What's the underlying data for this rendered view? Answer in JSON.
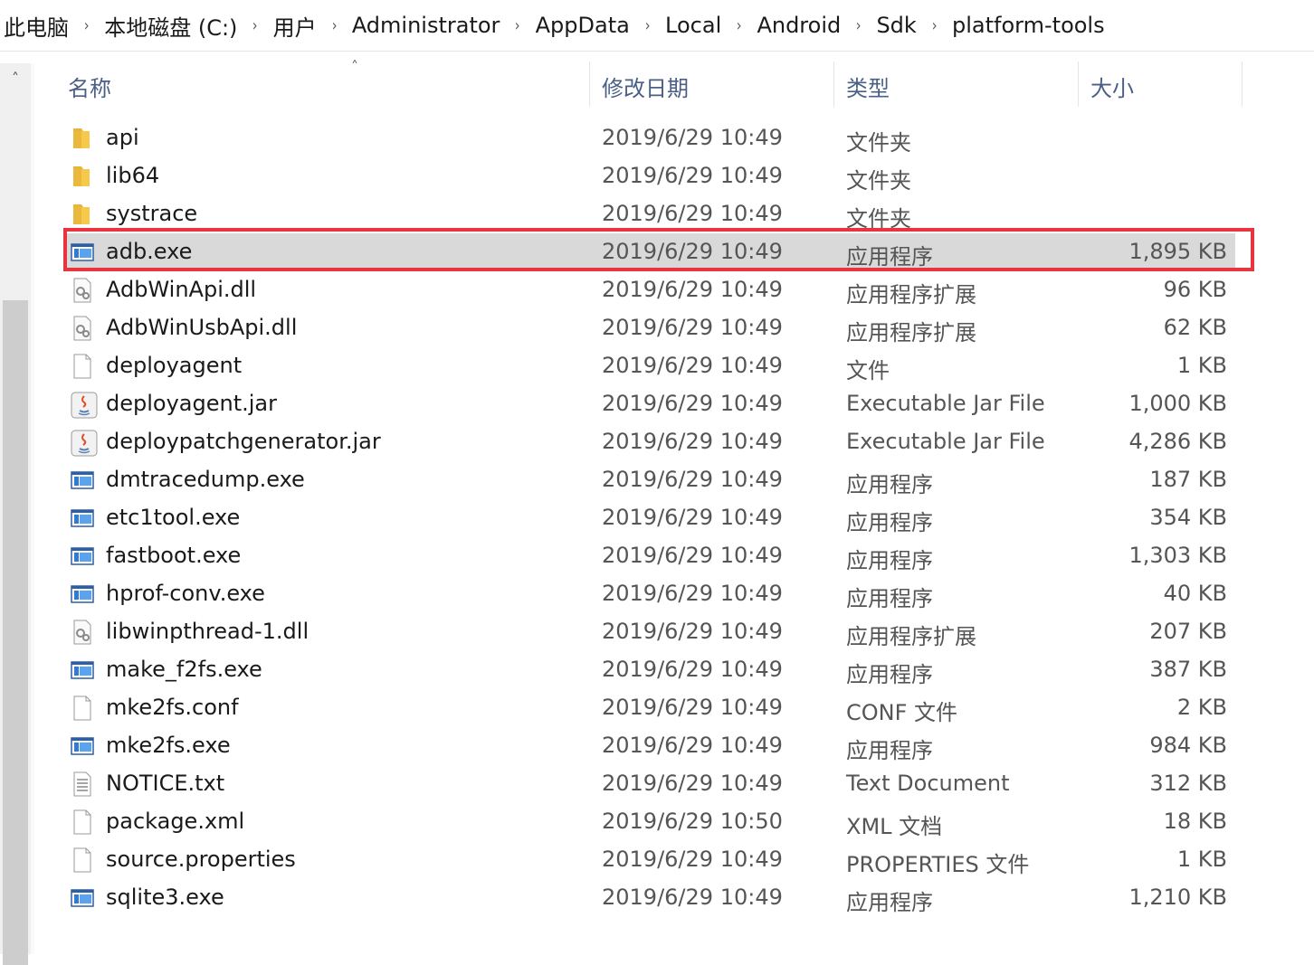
{
  "breadcrumb": [
    "此电脑",
    "本地磁盘 (C:)",
    "用户",
    "Administrator",
    "AppData",
    "Local",
    "Android",
    "Sdk",
    "platform-tools"
  ],
  "columns": {
    "name": "名称",
    "date": "修改日期",
    "type": "类型",
    "size": "大小"
  },
  "files": [
    {
      "name": "api",
      "date": "2019/6/29 10:49",
      "type": "文件夹",
      "size": "",
      "icon": "folder-icon"
    },
    {
      "name": "lib64",
      "date": "2019/6/29 10:49",
      "type": "文件夹",
      "size": "",
      "icon": "folder-icon"
    },
    {
      "name": "systrace",
      "date": "2019/6/29 10:49",
      "type": "文件夹",
      "size": "",
      "icon": "folder-icon"
    },
    {
      "name": "adb.exe",
      "date": "2019/6/29 10:49",
      "type": "应用程序",
      "size": "1,895 KB",
      "icon": "exe-icon",
      "selected": true
    },
    {
      "name": "AdbWinApi.dll",
      "date": "2019/6/29 10:49",
      "type": "应用程序扩展",
      "size": "96 KB",
      "icon": "dll-icon"
    },
    {
      "name": "AdbWinUsbApi.dll",
      "date": "2019/6/29 10:49",
      "type": "应用程序扩展",
      "size": "62 KB",
      "icon": "dll-icon"
    },
    {
      "name": "deployagent",
      "date": "2019/6/29 10:49",
      "type": "文件",
      "size": "1 KB",
      "icon": "file-icon"
    },
    {
      "name": "deployagent.jar",
      "date": "2019/6/29 10:49",
      "type": "Executable Jar File",
      "size": "1,000 KB",
      "icon": "java-icon"
    },
    {
      "name": "deploypatchgenerator.jar",
      "date": "2019/6/29 10:49",
      "type": "Executable Jar File",
      "size": "4,286 KB",
      "icon": "java-icon"
    },
    {
      "name": "dmtracedump.exe",
      "date": "2019/6/29 10:49",
      "type": "应用程序",
      "size": "187 KB",
      "icon": "exe-icon"
    },
    {
      "name": "etc1tool.exe",
      "date": "2019/6/29 10:49",
      "type": "应用程序",
      "size": "354 KB",
      "icon": "exe-icon"
    },
    {
      "name": "fastboot.exe",
      "date": "2019/6/29 10:49",
      "type": "应用程序",
      "size": "1,303 KB",
      "icon": "exe-icon"
    },
    {
      "name": "hprof-conv.exe",
      "date": "2019/6/29 10:49",
      "type": "应用程序",
      "size": "40 KB",
      "icon": "exe-icon"
    },
    {
      "name": "libwinpthread-1.dll",
      "date": "2019/6/29 10:49",
      "type": "应用程序扩展",
      "size": "207 KB",
      "icon": "dll-icon"
    },
    {
      "name": "make_f2fs.exe",
      "date": "2019/6/29 10:49",
      "type": "应用程序",
      "size": "387 KB",
      "icon": "exe-icon"
    },
    {
      "name": "mke2fs.conf",
      "date": "2019/6/29 10:49",
      "type": "CONF 文件",
      "size": "2 KB",
      "icon": "file-icon"
    },
    {
      "name": "mke2fs.exe",
      "date": "2019/6/29 10:49",
      "type": "应用程序",
      "size": "984 KB",
      "icon": "exe-icon"
    },
    {
      "name": "NOTICE.txt",
      "date": "2019/6/29 10:49",
      "type": "Text Document",
      "size": "312 KB",
      "icon": "text-file-icon"
    },
    {
      "name": "package.xml",
      "date": "2019/6/29 10:50",
      "type": "XML 文档",
      "size": "18 KB",
      "icon": "file-icon"
    },
    {
      "name": "source.properties",
      "date": "2019/6/29 10:49",
      "type": "PROPERTIES 文件",
      "size": "1 KB",
      "icon": "file-icon"
    },
    {
      "name": "sqlite3.exe",
      "date": "2019/6/29 10:49",
      "type": "应用程序",
      "size": "1,210 KB",
      "icon": "exe-icon"
    }
  ],
  "colors": {
    "highlight_border": "#e8343e",
    "selected_bg": "#d9d9d9",
    "header_text": "#4a5f86"
  }
}
